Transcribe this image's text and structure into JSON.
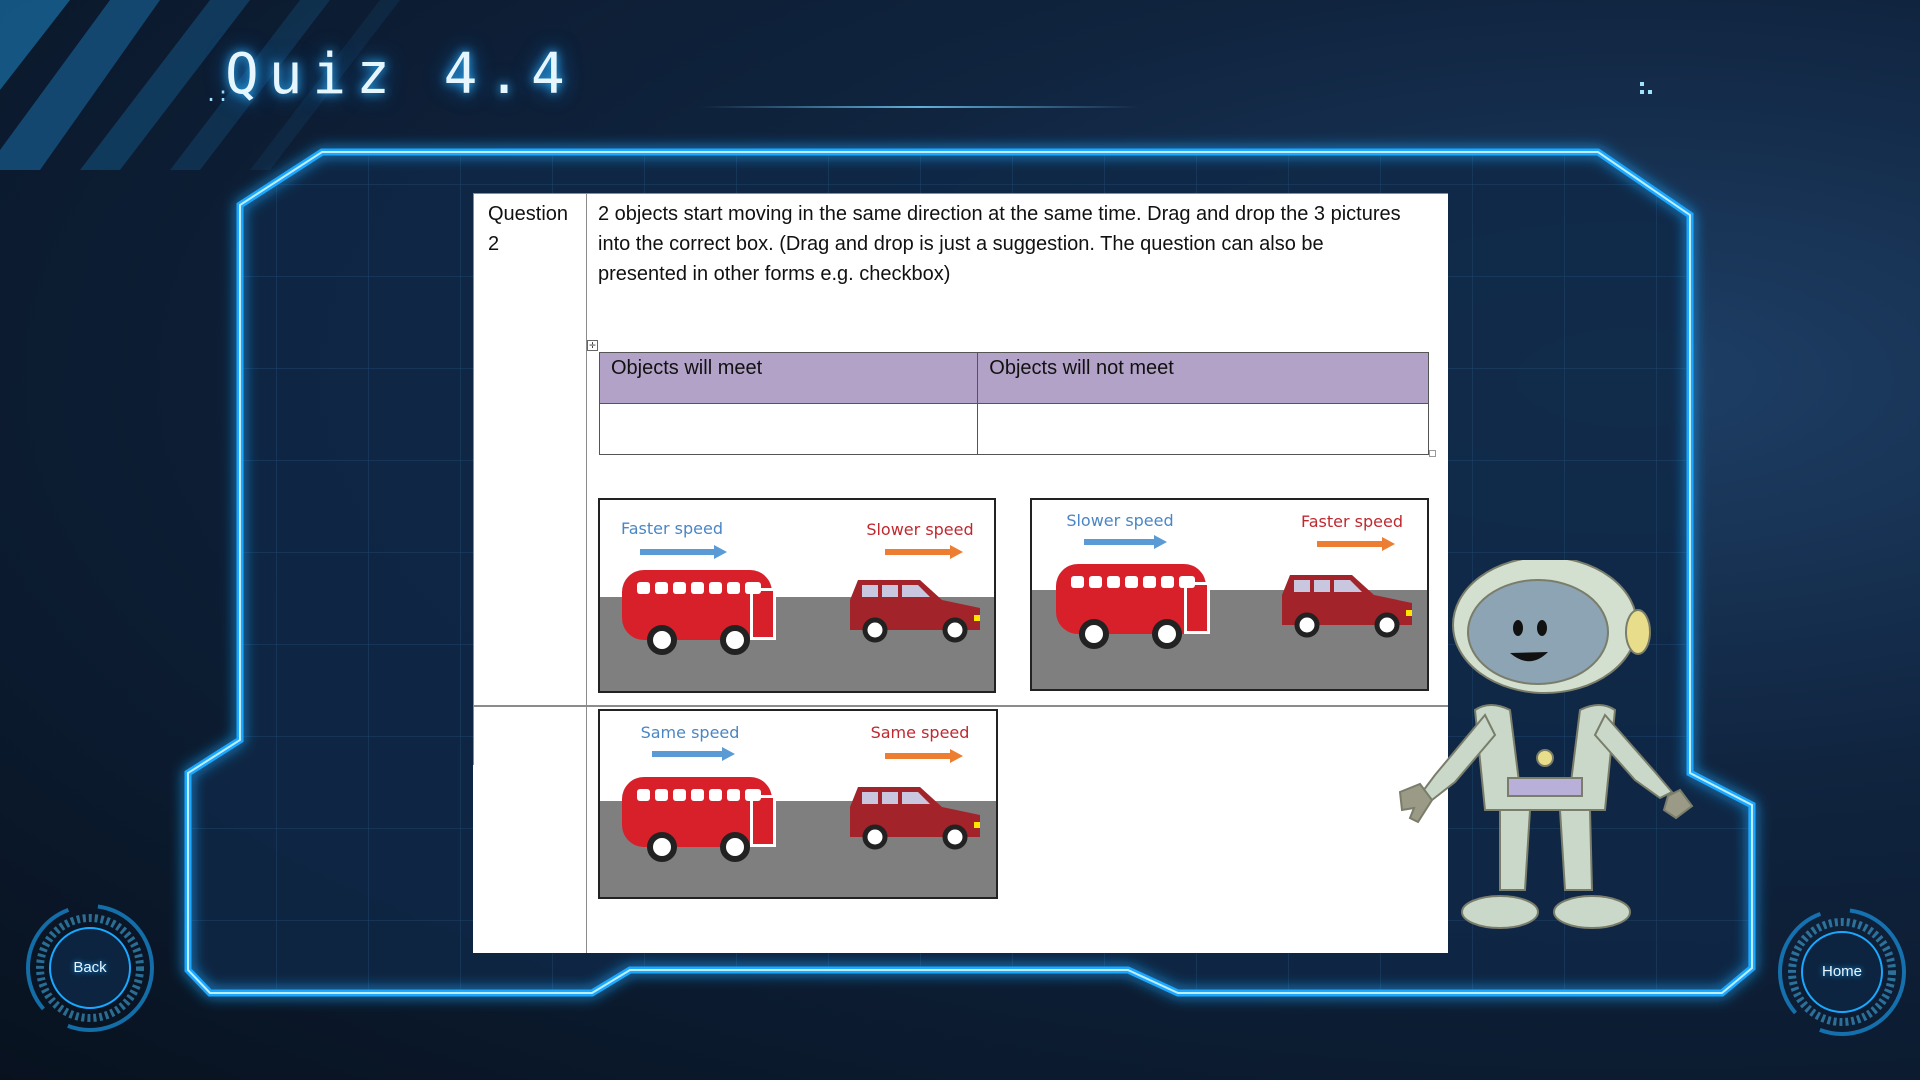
{
  "title": "Quiz 4.4",
  "colors": {
    "neon": "#1aa8ff",
    "header_fill": "#b3a2c8",
    "bus": "#d8202b",
    "car": "#a3232a",
    "left_arrow": "#5b9bd5",
    "right_arrow": "#ed7d31"
  },
  "question": {
    "label": "Question 2",
    "text": "2 objects start moving in the same direction at the same time. Drag and drop the 3 pictures into the correct box. (Drag and drop is just a suggestion. The question can also be presented in other forms e.g. checkbox)"
  },
  "answer_table": {
    "col1": "Objects will meet",
    "col2": "Objects will not meet"
  },
  "cards": [
    {
      "left_label": "Faster speed",
      "right_label": "Slower speed"
    },
    {
      "left_label": "Slower speed",
      "right_label": "Faster speed"
    },
    {
      "left_label": "Same speed",
      "right_label": "Same speed"
    }
  ],
  "nav": {
    "back": "Back",
    "home": "Home"
  },
  "icons": {
    "move": "move-handle-icon",
    "robot": "astronaut-robot-mascot"
  }
}
